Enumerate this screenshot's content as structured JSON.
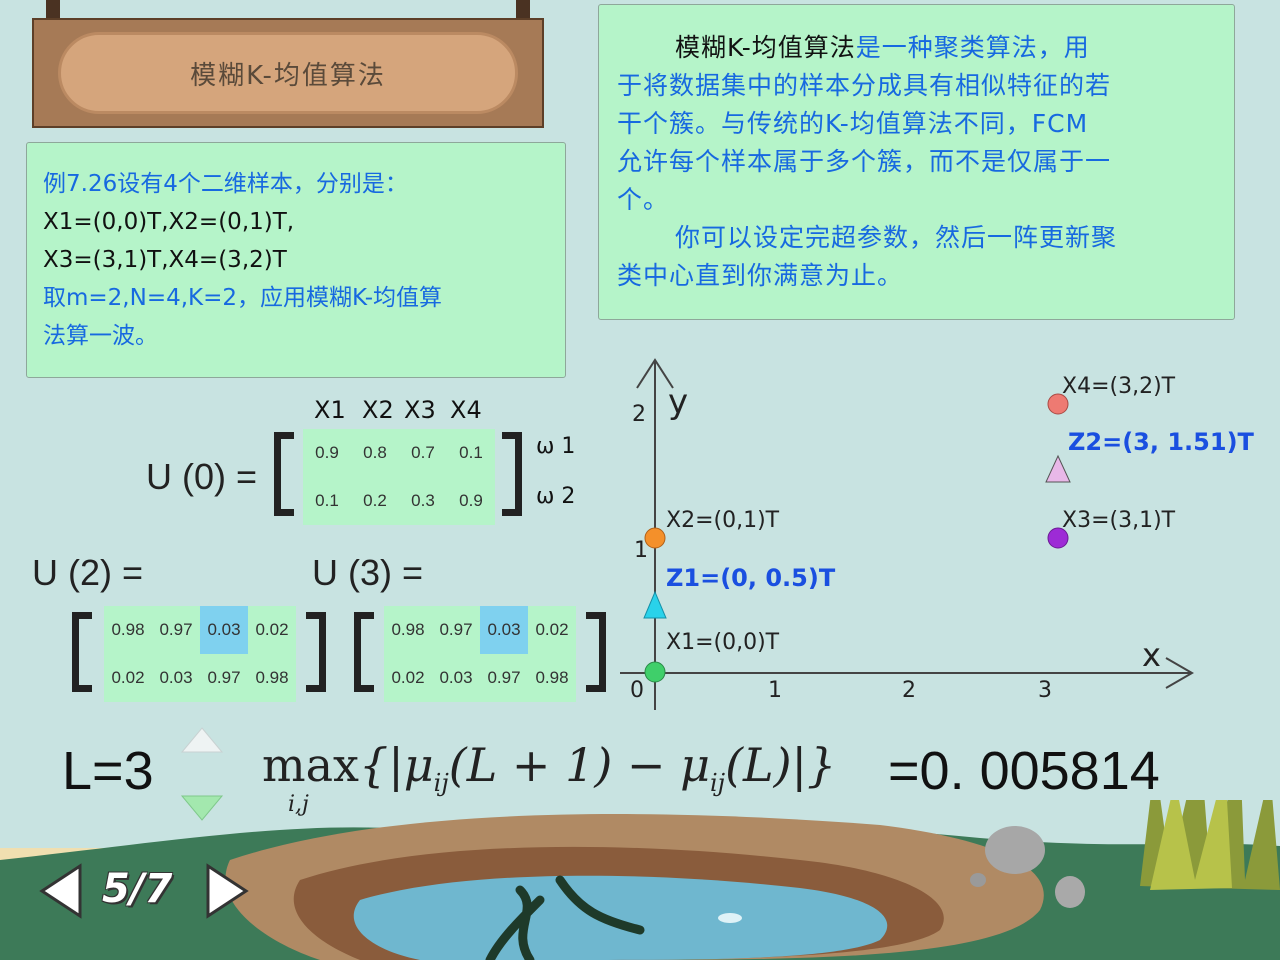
{
  "sign": {
    "title": "模糊K-均值算法"
  },
  "example": {
    "line1": "例7.26设有4个二维样本，分别是：",
    "line2": "X1=(0,0)T,X2=(0,1)T,",
    "line3": "X3=(3,1)T,X4=(3,2)T",
    "line4": "取m=2,N=4,K=2，应用模糊K-均值算",
    "line5": "法算一波。"
  },
  "description": {
    "p1_bold": "模糊K-均值算法",
    "p1_rest_a": "是一种聚类算法，用",
    "p1_line2": "于将数据集中的样本分成具有相似特征的若",
    "p1_line3": "干个簇。与传统的K-均值算法不同，FCM",
    "p1_line4": "允许每个样本属于多个簇，而不是仅属于一",
    "p1_line5": "个。",
    "p2_line1": "你可以设定完超参数，然后一阵更新聚",
    "p2_line2": "类中心直到你满意为止。"
  },
  "matrix_u0": {
    "label": "U (0) =",
    "col_headers": [
      "X1",
      "X2",
      "X3",
      "X4"
    ],
    "row_labels": [
      "ω 1",
      "ω 2"
    ],
    "rows": [
      [
        "0.9",
        "0.8",
        "0.7",
        "0.1"
      ],
      [
        "0.1",
        "0.2",
        "0.3",
        "0.9"
      ]
    ]
  },
  "matrix_u2": {
    "label": "U (2) =",
    "rows": [
      [
        "0.98",
        "0.97",
        "0.03",
        "0.02"
      ],
      [
        "0.02",
        "0.03",
        "0.97",
        "0.98"
      ]
    ]
  },
  "matrix_u3": {
    "label": "U (3) =",
    "rows": [
      [
        "0.98",
        "0.97",
        "0.03",
        "0.02"
      ],
      [
        "0.02",
        "0.03",
        "0.97",
        "0.98"
      ]
    ]
  },
  "graph": {
    "y_axis_label": "y",
    "x_axis_label": "x",
    "y_ticks": [
      "2",
      "1"
    ],
    "x_ticks": [
      "0",
      "1",
      "2",
      "3"
    ],
    "points": {
      "x1": "X1=(0,0)T",
      "x2": "X2=(0,1)T",
      "x3": "X3=(3,1)T",
      "x4": "X4=(3,2)T",
      "z1": "Z1=(0, 0.5)T",
      "z2": "Z2=(3, 1.51)T"
    },
    "colors": {
      "x1": "#3fcf6a",
      "x2": "#f4902a",
      "x3": "#9d2bd6",
      "x4": "#ee7a72",
      "z1": "#29d2ea",
      "z2": "#e8b8e8"
    }
  },
  "controls": {
    "l_label": "L=3",
    "max_value": "=0. 005814",
    "max_sub": "i,j",
    "page": "5/7"
  }
}
